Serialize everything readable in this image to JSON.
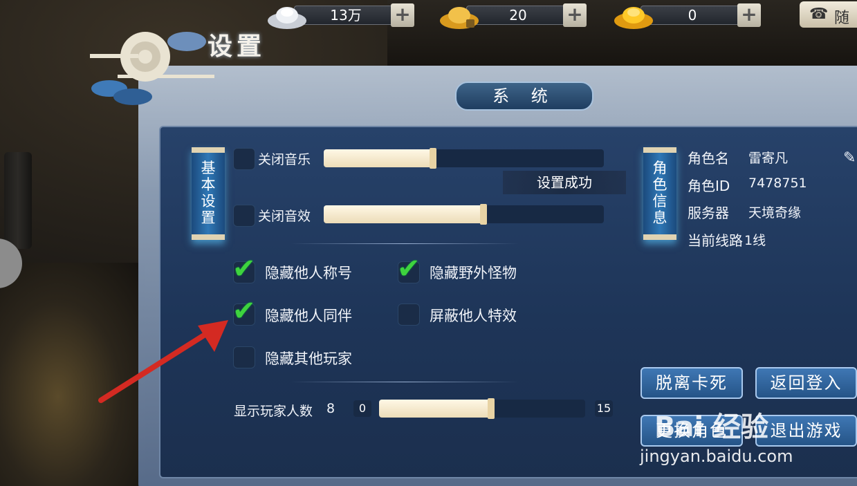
{
  "currencies": [
    {
      "name": "silver",
      "value": "13万"
    },
    {
      "name": "gold-bound",
      "value": "20"
    },
    {
      "name": "gold",
      "value": "0"
    }
  ],
  "top_right_label": "随",
  "title": "设置",
  "tab": "系 统",
  "basic_settings_scroll": [
    "基",
    "本",
    "设",
    "置"
  ],
  "role_scroll": [
    "角",
    "色",
    "信",
    "息"
  ],
  "audio": {
    "music": {
      "label": "关闭音乐",
      "checked": false,
      "level": 0.4
    },
    "sfx": {
      "label": "关闭音效",
      "checked": false,
      "level": 0.58
    }
  },
  "toast": "设置成功",
  "options": [
    {
      "label": "隐藏他人称号",
      "checked": true
    },
    {
      "label": "隐藏野外怪物",
      "checked": true
    },
    {
      "label": "隐藏他人同伴",
      "checked": true
    },
    {
      "label": "屏蔽他人特效",
      "checked": false
    },
    {
      "label": "隐藏其他玩家",
      "checked": false
    }
  ],
  "player_count": {
    "label": "显示玩家人数",
    "value": "8",
    "min": "0",
    "max": "15",
    "fraction": 0.53
  },
  "role_info": [
    {
      "key": "角色名",
      "value": "雷寄凡"
    },
    {
      "key": "角色ID",
      "value": "7478751"
    },
    {
      "key": "服务器",
      "value": "天境奇缘"
    },
    {
      "key": "当前线路",
      "value": "1线"
    }
  ],
  "buttons": {
    "unstuck": "脱离卡死",
    "back_login": "返回登入",
    "change_role": "更换角色",
    "exit_game": "退出游戏"
  },
  "watermark": {
    "brand": "Bai 经验",
    "url": "jingyan.baidu.com"
  },
  "colors": {
    "check": "#3ed33e",
    "panel": "#1e3558",
    "accent": "#2f78b6",
    "arrow": "#d42a22"
  }
}
